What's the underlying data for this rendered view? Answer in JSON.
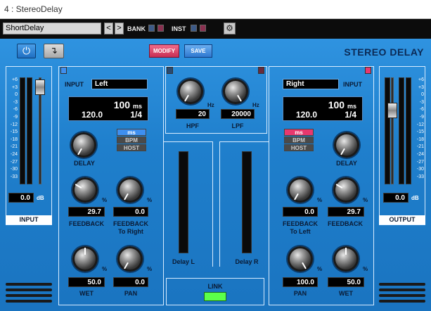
{
  "window": {
    "title": "4 : StereoDelay"
  },
  "toolbar": {
    "preset": "ShortDelay",
    "prev": "<",
    "next": ">",
    "bank_label": "BANK",
    "inst_label": "INST"
  },
  "header": {
    "modify": "MODIFY",
    "save": "SAVE",
    "brand": "STEREO DELAY"
  },
  "input_meter": {
    "label": "INPUT",
    "value": "0.0",
    "unit": "dB",
    "level": 0.0
  },
  "output_meter": {
    "label": "OUTPUT",
    "value": "0.0",
    "unit": "dB",
    "level": 0.0
  },
  "scale": [
    "+6",
    "+3",
    "0",
    "-3",
    "-6",
    "-9",
    "-12",
    "-15",
    "-18",
    "-21",
    "-24",
    "-27",
    "-30",
    "-33"
  ],
  "left": {
    "input_label": "INPUT",
    "input_value": "Left",
    "time": "100",
    "time_unit": "ms",
    "bpm": "120.0",
    "note": "1/4",
    "modes": [
      "ms",
      "BPM",
      "HOST"
    ],
    "delay_label": "DELAY",
    "feedback_value": "29.7",
    "feedback_label": "FEEDBACK",
    "cross_value": "0.0",
    "cross_label1": "FEEDBACK",
    "cross_label2": "To Right",
    "wet_value": "50.0",
    "wet_label": "WET",
    "pan_value": "0.0",
    "pan_label": "PAN",
    "pct": "%"
  },
  "right": {
    "input_label": "INPUT",
    "input_value": "Right",
    "time": "100",
    "time_unit": "ms",
    "bpm": "120.0",
    "note": "1/4",
    "modes": [
      "ms",
      "BPM",
      "HOST"
    ],
    "delay_label": "DELAY",
    "feedback_value": "29.7",
    "feedback_label": "FEEDBACK",
    "cross_value": "0.0",
    "cross_label1": "FEEDBACK",
    "cross_label2": "To Left",
    "wet_value": "50.0",
    "wet_label": "WET",
    "pan_value": "100.0",
    "pan_label": "PAN",
    "pct": "%"
  },
  "filters": {
    "hpf_value": "20",
    "hpf_label": "HPF",
    "lpf_value": "20000",
    "lpf_label": "LPF",
    "unit": "Hz"
  },
  "center": {
    "delay_l": "Delay L",
    "delay_r": "Delay R",
    "link": "LINK"
  },
  "colors": {
    "accent": "#1f7fcc",
    "link_led": "#5cff4a",
    "mode_left": "#3e8ff0",
    "mode_right": "#e8386e"
  }
}
